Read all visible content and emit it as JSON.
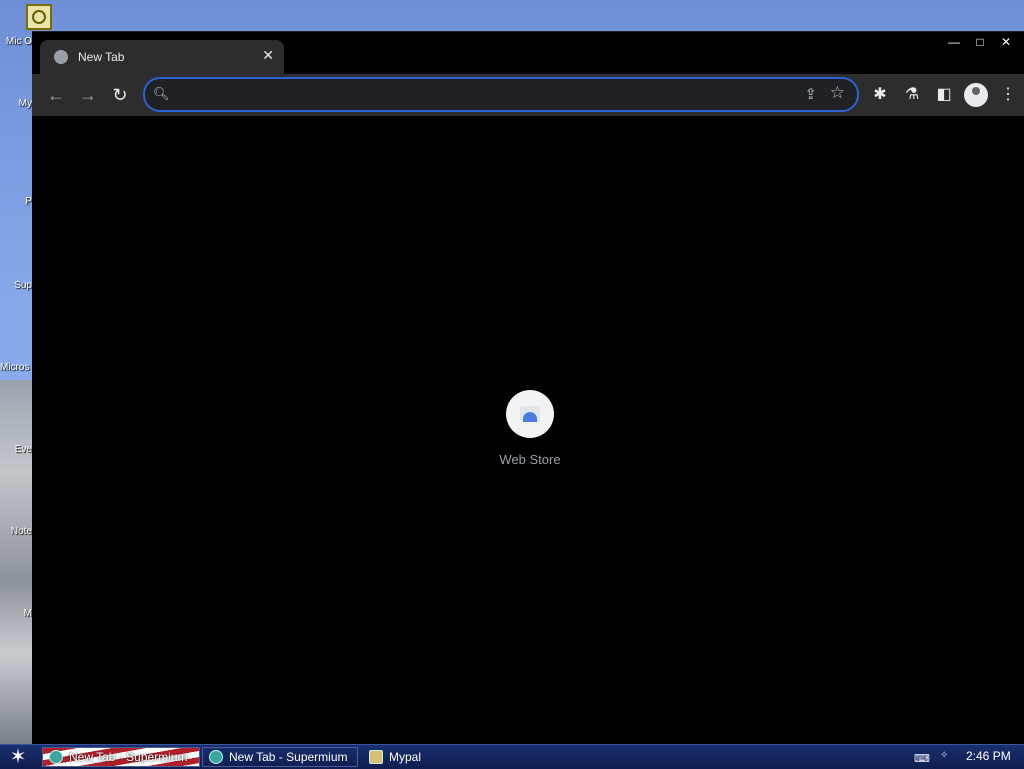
{
  "desktop": {
    "icons": [
      {
        "label": "Mic O"
      },
      {
        "label": "My"
      },
      {
        "label": "P"
      },
      {
        "label": "Sup"
      },
      {
        "label": "Micros Studi"
      },
      {
        "label": "Eve"
      },
      {
        "label": "Note"
      },
      {
        "label": "M"
      }
    ]
  },
  "browser": {
    "tab": {
      "title": "New Tab",
      "close_glyph": "✕"
    },
    "window_controls": {
      "minimize": "—",
      "maximize": "□",
      "close": "✕"
    },
    "toolbar": {
      "back_glyph": "←",
      "forward_glyph": "→",
      "reload_glyph": "↻",
      "omnibox": {
        "value": "",
        "placeholder": ""
      },
      "share_glyph": "⇪",
      "star_glyph": "☆",
      "extensions_glyph": "✱",
      "labs_glyph": "⚗",
      "sidepanel_glyph": "◧",
      "menu_glyph": "⋮"
    },
    "shortcuts": [
      {
        "label": "Web Store"
      }
    ]
  },
  "taskbar": {
    "start_glyph": "✶",
    "tasks": [
      {
        "label": "New Tab - Supermium"
      },
      {
        "label": "New Tab - Supermium"
      },
      {
        "label": "Mypal"
      }
    ],
    "clock": "2:46 PM"
  },
  "colors": {
    "omnibox_focus": "#2b63d6",
    "toolbar_bg": "#2d2d2d",
    "page_bg": "#000000"
  }
}
